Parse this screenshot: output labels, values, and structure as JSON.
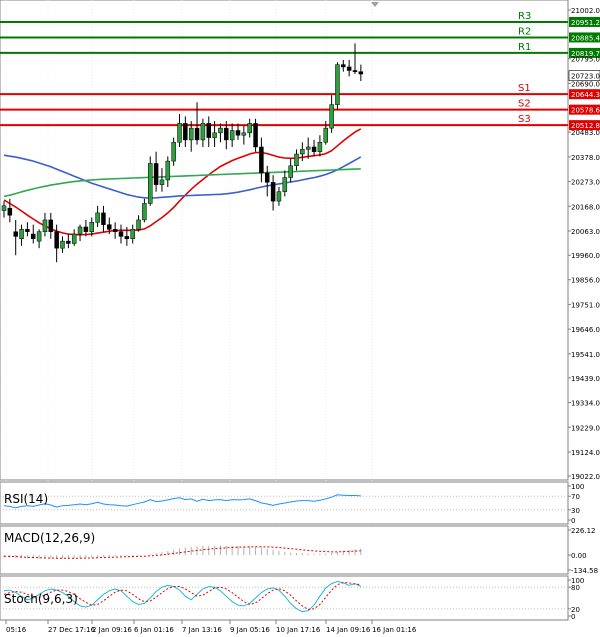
{
  "chart_data": {
    "type": "candlestick",
    "price_axis": {
      "ticks": [
        "21002.0",
        "20795.0",
        "20690.0",
        "20483.0",
        "20378.0",
        "20273.0",
        "20168.0",
        "20063.0",
        "19960.0",
        "19856.0",
        "19751.0",
        "19646.0",
        "19541.0",
        "19439.0",
        "19334.0",
        "19229.0",
        "19124.0",
        "19022.0"
      ],
      "current_price": "20723.0",
      "ylim": [
        19022.0,
        21002.0
      ]
    },
    "levels": [
      {
        "label": "R3",
        "value": 20951.2,
        "text": "20951.2",
        "color": "#007a00"
      },
      {
        "label": "R2",
        "value": 20885.4,
        "text": "20885.4",
        "color": "#007a00"
      },
      {
        "label": "R1",
        "value": 20819.7,
        "text": "20819.7",
        "color": "#007a00"
      },
      {
        "label": "S1",
        "value": 20644.3,
        "text": "20644.3",
        "color": "#e00000"
      },
      {
        "label": "S2",
        "value": 20578.6,
        "text": "20578.6",
        "color": "#e00000"
      },
      {
        "label": "S3",
        "value": 20512.8,
        "text": "20512.8",
        "color": "#e00000"
      }
    ],
    "candles": [
      [
        20150,
        20190,
        20120,
        20170
      ],
      [
        20160,
        20200,
        20100,
        20130
      ],
      [
        20060,
        20110,
        19960,
        20040
      ],
      [
        20030,
        20090,
        20000,
        20070
      ],
      [
        20070,
        20100,
        20040,
        20060
      ],
      [
        20050,
        20090,
        20010,
        20030
      ],
      [
        20020,
        20070,
        19990,
        20060
      ],
      [
        20060,
        20140,
        20040,
        20110
      ],
      [
        20110,
        20140,
        20030,
        20060
      ],
      [
        20060,
        20090,
        19930,
        19990
      ],
      [
        19990,
        20040,
        19970,
        20020
      ],
      [
        20020,
        20050,
        19990,
        20010
      ],
      [
        20010,
        20070,
        20000,
        20050
      ],
      [
        20050,
        20090,
        20020,
        20080
      ],
      [
        20080,
        20110,
        20040,
        20060
      ],
      [
        20060,
        20120,
        20040,
        20100
      ],
      [
        20100,
        20170,
        20080,
        20140
      ],
      [
        20140,
        20170,
        20060,
        20090
      ],
      [
        20090,
        20120,
        20050,
        20070
      ],
      [
        20070,
        20100,
        20030,
        20060
      ],
      [
        20060,
        20090,
        20010,
        20040
      ],
      [
        20040,
        20080,
        20000,
        20030
      ],
      [
        20030,
        20090,
        20010,
        20070
      ],
      [
        20070,
        20130,
        20060,
        20110
      ],
      [
        20110,
        20200,
        20100,
        20180
      ],
      [
        20180,
        20380,
        20170,
        20350
      ],
      [
        20350,
        20400,
        20230,
        20260
      ],
      [
        20260,
        20330,
        20230,
        20280
      ],
      [
        20280,
        20380,
        20250,
        20360
      ],
      [
        20360,
        20460,
        20340,
        20440
      ],
      [
        20440,
        20560,
        20420,
        20520
      ],
      [
        20520,
        20550,
        20420,
        20450
      ],
      [
        20450,
        20530,
        20400,
        20500
      ],
      [
        20500,
        20610,
        20430,
        20450
      ],
      [
        20450,
        20540,
        20420,
        20520
      ],
      [
        20520,
        20550,
        20420,
        20460
      ],
      [
        20460,
        20530,
        20420,
        20480
      ],
      [
        20480,
        20520,
        20440,
        20500
      ],
      [
        20500,
        20530,
        20410,
        20450
      ],
      [
        20450,
        20520,
        20420,
        20490
      ],
      [
        20490,
        20520,
        20450,
        20470
      ],
      [
        20470,
        20510,
        20430,
        20480
      ],
      [
        20480,
        20540,
        20460,
        20520
      ],
      [
        20520,
        20540,
        20400,
        20420
      ],
      [
        20420,
        20460,
        20270,
        20310
      ],
      [
        20310,
        20340,
        20210,
        20270
      ],
      [
        20270,
        20300,
        20150,
        20190
      ],
      [
        20190,
        20250,
        20170,
        20230
      ],
      [
        20230,
        20320,
        20210,
        20290
      ],
      [
        20290,
        20370,
        20270,
        20340
      ],
      [
        20340,
        20410,
        20320,
        20390
      ],
      [
        20390,
        20440,
        20360,
        20410
      ],
      [
        20410,
        20460,
        20370,
        20420
      ],
      [
        20420,
        20450,
        20380,
        20400
      ],
      [
        20400,
        20470,
        20380,
        20440
      ],
      [
        20440,
        20530,
        20430,
        20500
      ],
      [
        20500,
        20640,
        20480,
        20600
      ],
      [
        20600,
        20780,
        20580,
        20770
      ],
      [
        20770,
        20790,
        20740,
        20760
      ],
      [
        20760,
        20790,
        20720,
        20745
      ],
      [
        20745,
        20860,
        20730,
        20740
      ],
      [
        20740,
        20770,
        20700,
        20730
      ]
    ],
    "moving_averages": [
      {
        "color": "#e00000",
        "values": [
          20195,
          20180,
          20165,
          20148,
          20130,
          20114,
          20098,
          20085,
          20073,
          20062,
          20055,
          20050,
          20048,
          20047,
          20048,
          20050,
          20054,
          20058,
          20062,
          20065,
          20066,
          20066,
          20066,
          20067,
          20072,
          20085,
          20103,
          20120,
          20140,
          20163,
          20190,
          20215,
          20240,
          20262,
          20282,
          20302,
          20320,
          20337,
          20350,
          20362,
          20372,
          20381,
          20390,
          20396,
          20396,
          20392,
          20384,
          20377,
          20373,
          20372,
          20373,
          20376,
          20380,
          20383,
          20386,
          20392,
          20404,
          20425,
          20446,
          20465,
          20483,
          20497
        ]
      },
      {
        "color": "#3a5fcd",
        "values": [
          20385,
          20381,
          20377,
          20372,
          20366,
          20360,
          20352,
          20344,
          20336,
          20326,
          20316,
          20306,
          20296,
          20286,
          20276,
          20266,
          20258,
          20250,
          20242,
          20234,
          20226,
          20218,
          20212,
          20207,
          20204,
          20203,
          20204,
          20206,
          20208,
          20210,
          20212,
          20213,
          20214,
          20215,
          20216,
          20217,
          20218,
          20219,
          20221,
          20224,
          20228,
          20233,
          20238,
          20244,
          20250,
          20255,
          20259,
          20263,
          20267,
          20271,
          20275,
          20280,
          20285,
          20290,
          20296,
          20303,
          20312,
          20323,
          20336,
          20350,
          20364,
          20378
        ]
      },
      {
        "color": "#2fa84f",
        "values": [
          20210,
          20215,
          20222,
          20229,
          20236,
          20242,
          20248,
          20253,
          20258,
          20262,
          20266,
          20270,
          20273,
          20276,
          20278,
          20280,
          20282,
          20283,
          20284,
          20285,
          20286,
          20287,
          20288,
          20289,
          20290,
          20291,
          20292,
          20293,
          20294,
          20295,
          20296,
          20297,
          20298,
          20299,
          20300,
          20301,
          20302,
          20303,
          20304,
          20305,
          20306,
          20307,
          20308,
          20309,
          20310,
          20311,
          20312,
          20313,
          20314,
          20315,
          20316,
          20317,
          20318,
          20319,
          20320,
          20321,
          20322,
          20323,
          20324,
          20325,
          20326,
          20327
        ]
      }
    ],
    "time_labels": [
      "05:16",
      "27 Dec 17:16",
      "2 Jan 09:16",
      "6 Jan 01:16",
      "7 Jan 13:16",
      "9 Jan 05:16",
      "10 Jan 17:16",
      "14 Jan 09:16",
      "16 Jan 01:16"
    ],
    "panels": {
      "rsi": {
        "label": "RSI(14)",
        "ticks": [
          "100",
          "70",
          "30",
          "0"
        ],
        "ylim": [
          0,
          100
        ],
        "values": [
          42,
          40,
          36,
          40,
          42,
          40,
          44,
          48,
          44,
          38,
          42,
          43,
          45,
          47,
          45,
          48,
          52,
          47,
          45,
          44,
          42,
          41,
          45,
          49,
          53,
          60,
          54,
          56,
          59,
          63,
          66,
          60,
          62,
          55,
          61,
          57,
          59,
          60,
          57,
          60,
          59,
          60,
          62,
          57,
          50,
          47,
          43,
          47,
          50,
          53,
          56,
          57,
          57,
          55,
          58,
          62,
          67,
          74,
          73,
          72,
          72,
          71
        ]
      },
      "macd": {
        "label": "MACD(12,26,9)",
        "ticks": [
          "226.12",
          "0.00",
          "-134.58"
        ],
        "ylim": [
          -134.58,
          226.12
        ],
        "histogram": [
          -20,
          -22,
          -25,
          -28,
          -30,
          -31,
          -32,
          -31,
          -30,
          -31,
          -32,
          -31,
          -29,
          -27,
          -24,
          -21,
          -17,
          -14,
          -12,
          -11,
          -10,
          -9,
          -8,
          -6,
          -2,
          8,
          18,
          26,
          36,
          47,
          60,
          68,
          74,
          78,
          82,
          84,
          85,
          86,
          85,
          84,
          82,
          80,
          78,
          75,
          68,
          58,
          46,
          36,
          28,
          22,
          18,
          16,
          14,
          13,
          13,
          14,
          18,
          28,
          38,
          46,
          53,
          58
        ],
        "signal": [
          -10,
          -12,
          -14,
          -17,
          -20,
          -22,
          -24,
          -26,
          -27,
          -28,
          -29,
          -29,
          -29,
          -28,
          -27,
          -26,
          -24,
          -22,
          -20,
          -18,
          -16,
          -15,
          -13,
          -12,
          -10,
          -7,
          -3,
          2,
          8,
          15,
          22,
          29,
          36,
          42,
          48,
          53,
          58,
          62,
          66,
          69,
          71,
          73,
          74,
          75,
          75,
          74,
          72,
          68,
          63,
          58,
          52,
          47,
          42,
          38,
          34,
          31,
          29,
          29,
          31,
          33,
          36,
          39
        ]
      },
      "stoch": {
        "label": "Stoch(9,6,3)",
        "ticks": [
          "100",
          "80",
          "20",
          "0"
        ],
        "ylim": [
          0,
          100
        ],
        "k": [
          70,
          72,
          65,
          55,
          45,
          50,
          60,
          70,
          75,
          72,
          65,
          55,
          40,
          28,
          25,
          30,
          45,
          60,
          70,
          75,
          70,
          55,
          40,
          32,
          35,
          50,
          68,
          80,
          85,
          82,
          72,
          55,
          45,
          60,
          75,
          82,
          80,
          70,
          55,
          40,
          30,
          28,
          35,
          50,
          65,
          75,
          78,
          72,
          55,
          35,
          20,
          12,
          15,
          30,
          55,
          78,
          90,
          96,
          92,
          85,
          90,
          82
        ],
        "d": [
          60,
          65,
          68,
          66,
          60,
          55,
          52,
          58,
          66,
          72,
          72,
          68,
          60,
          48,
          38,
          30,
          32,
          42,
          55,
          66,
          72,
          70,
          60,
          48,
          40,
          42,
          52,
          65,
          76,
          82,
          82,
          75,
          65,
          55,
          58,
          68,
          78,
          80,
          75,
          65,
          52,
          40,
          32,
          36,
          48,
          62,
          72,
          76,
          70,
          58,
          42,
          28,
          18,
          20,
          32,
          52,
          72,
          87,
          93,
          92,
          89,
          87
        ]
      }
    }
  }
}
